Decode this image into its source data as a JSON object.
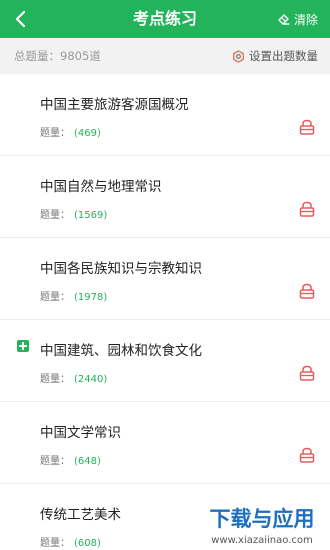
{
  "header": {
    "title": "考点练习",
    "clear_label": "清除",
    "accent_color": "#22b35b"
  },
  "subbar": {
    "total_label": "总题量：9805道",
    "settings_label": "设置出题数量"
  },
  "list": {
    "count_label": "题量：",
    "items": [
      {
        "name": "中国主要旅游客源国概况",
        "count": "(469)",
        "expandable": false,
        "locked": true
      },
      {
        "name": "中国自然与地理常识",
        "count": "(1569)",
        "expandable": false,
        "locked": true
      },
      {
        "name": "中国各民族知识与宗教知识",
        "count": "(1978)",
        "expandable": false,
        "locked": true
      },
      {
        "name": "中国建筑、园林和饮食文化",
        "count": "(2440)",
        "expandable": true,
        "locked": true
      },
      {
        "name": "中国文学常识",
        "count": "(648)",
        "expandable": false,
        "locked": true
      },
      {
        "name": "传统工艺美术",
        "count": "(608)",
        "expandable": false,
        "locked": false
      }
    ]
  },
  "watermark": {
    "text": "下载与应用",
    "url_text": "www.xiazaiinao.com"
  }
}
